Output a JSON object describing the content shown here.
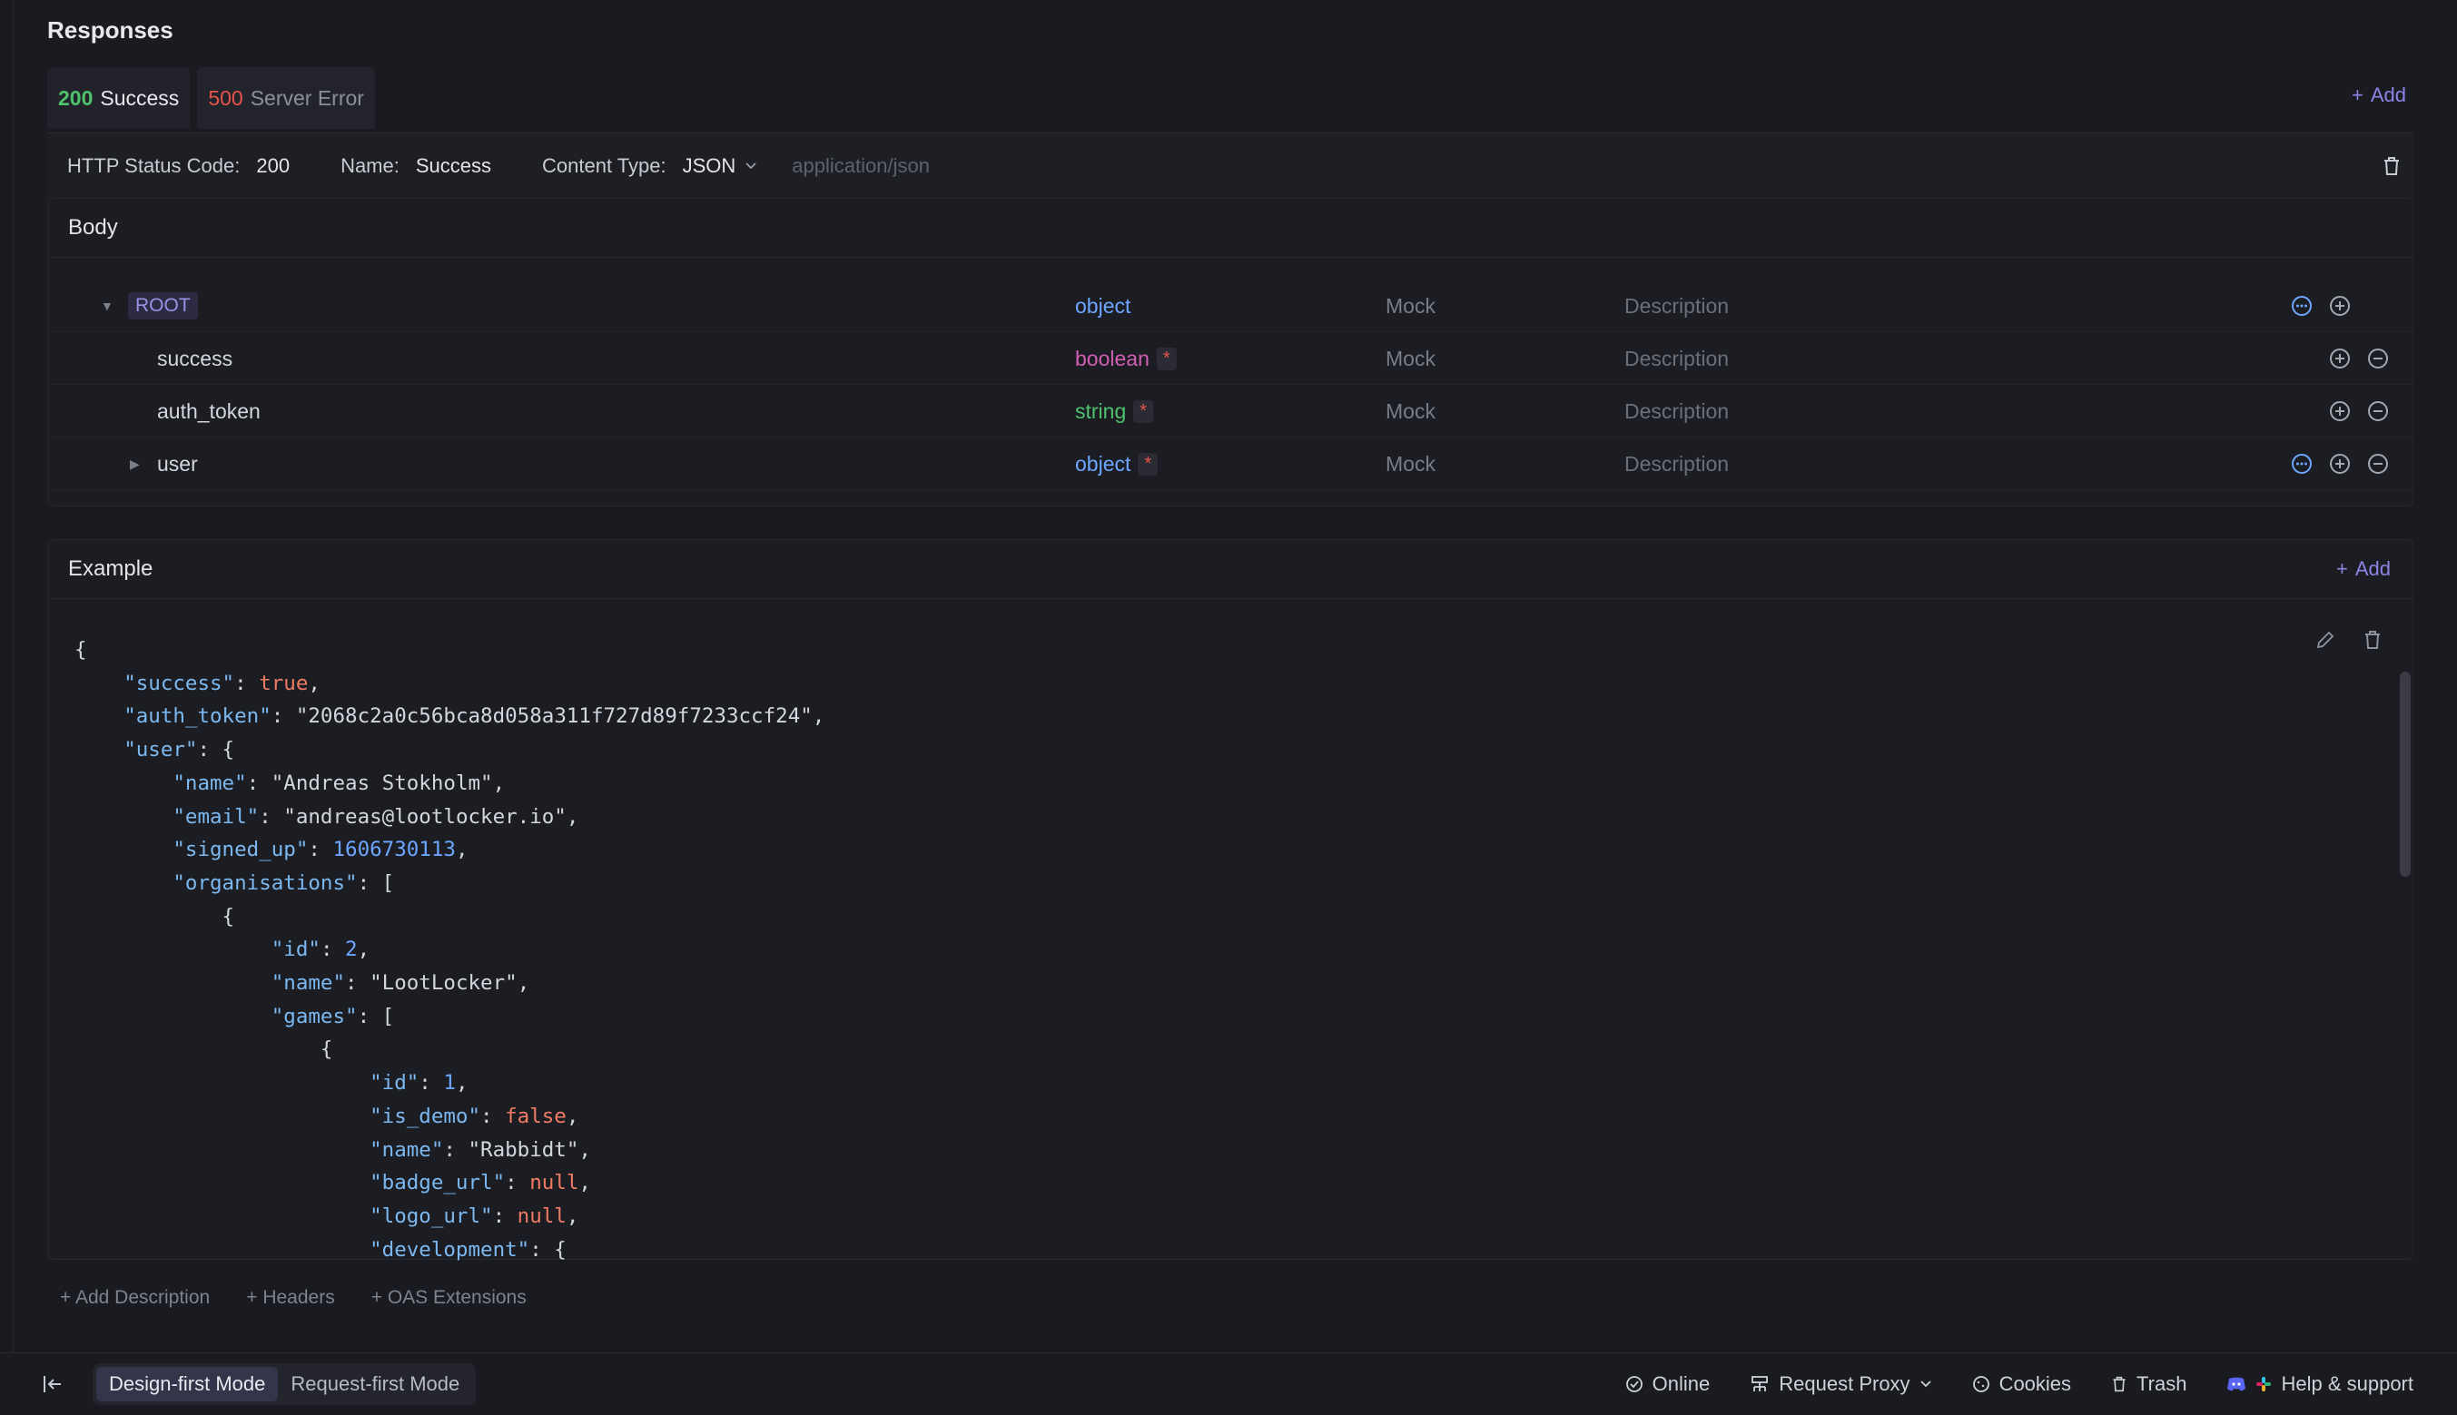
{
  "page": {
    "title": "Responses"
  },
  "tabs": [
    {
      "code": "200",
      "label": "Success"
    },
    {
      "code": "500",
      "label": "Server Error"
    }
  ],
  "add_label": "Add",
  "meta": {
    "status_label": "HTTP Status Code:",
    "status_value": "200",
    "name_label": "Name:",
    "name_value": "Success",
    "content_type_label": "Content Type:",
    "content_type_value": "JSON",
    "content_type_mime": "application/json"
  },
  "body": {
    "title": "Body",
    "rows": [
      {
        "name": "ROOT",
        "type": "object",
        "required": false,
        "mock": "Mock",
        "description": "Description"
      },
      {
        "name": "success",
        "type": "boolean",
        "required": true,
        "mock": "Mock",
        "description": "Description"
      },
      {
        "name": "auth_token",
        "type": "string",
        "required": true,
        "mock": "Mock",
        "description": "Description"
      },
      {
        "name": "user",
        "type": "object",
        "required": true,
        "mock": "Mock",
        "description": "Description"
      }
    ],
    "required_mark": "*"
  },
  "example": {
    "title": "Example",
    "add_label": "Add",
    "lines": [
      "{",
      "    \"success\": true,",
      "    \"auth_token\": \"2068c2a0c56bca8d058a311f727d89f7233ccf24\",",
      "    \"user\": {",
      "        \"name\": \"Andreas Stokholm\",",
      "        \"email\": \"andreas@lootlocker.io\",",
      "        \"signed_up\": 1606730113,",
      "        \"organisations\": [",
      "            {",
      "                \"id\": 2,",
      "                \"name\": \"LootLocker\",",
      "                \"games\": [",
      "                    {",
      "                        \"id\": 1,",
      "                        \"is_demo\": false,",
      "                        \"name\": \"Rabbidt\",",
      "                        \"badge_url\": null,",
      "                        \"logo_url\": null,",
      "                        \"development\": {"
    ]
  },
  "footer_links": [
    "Add Description",
    "Headers",
    "OAS Extensions"
  ],
  "statusbar": {
    "modes": [
      "Design-first Mode",
      "Request-first Mode"
    ],
    "items": [
      "Online",
      "Request Proxy",
      "Cookies",
      "Trash",
      "Help & support"
    ]
  },
  "colors": {
    "success": "#4fc26e",
    "error": "#e5534b",
    "accent": "#8f84e6",
    "object": "#6ca6ff",
    "boolean": "#d15fb4"
  }
}
